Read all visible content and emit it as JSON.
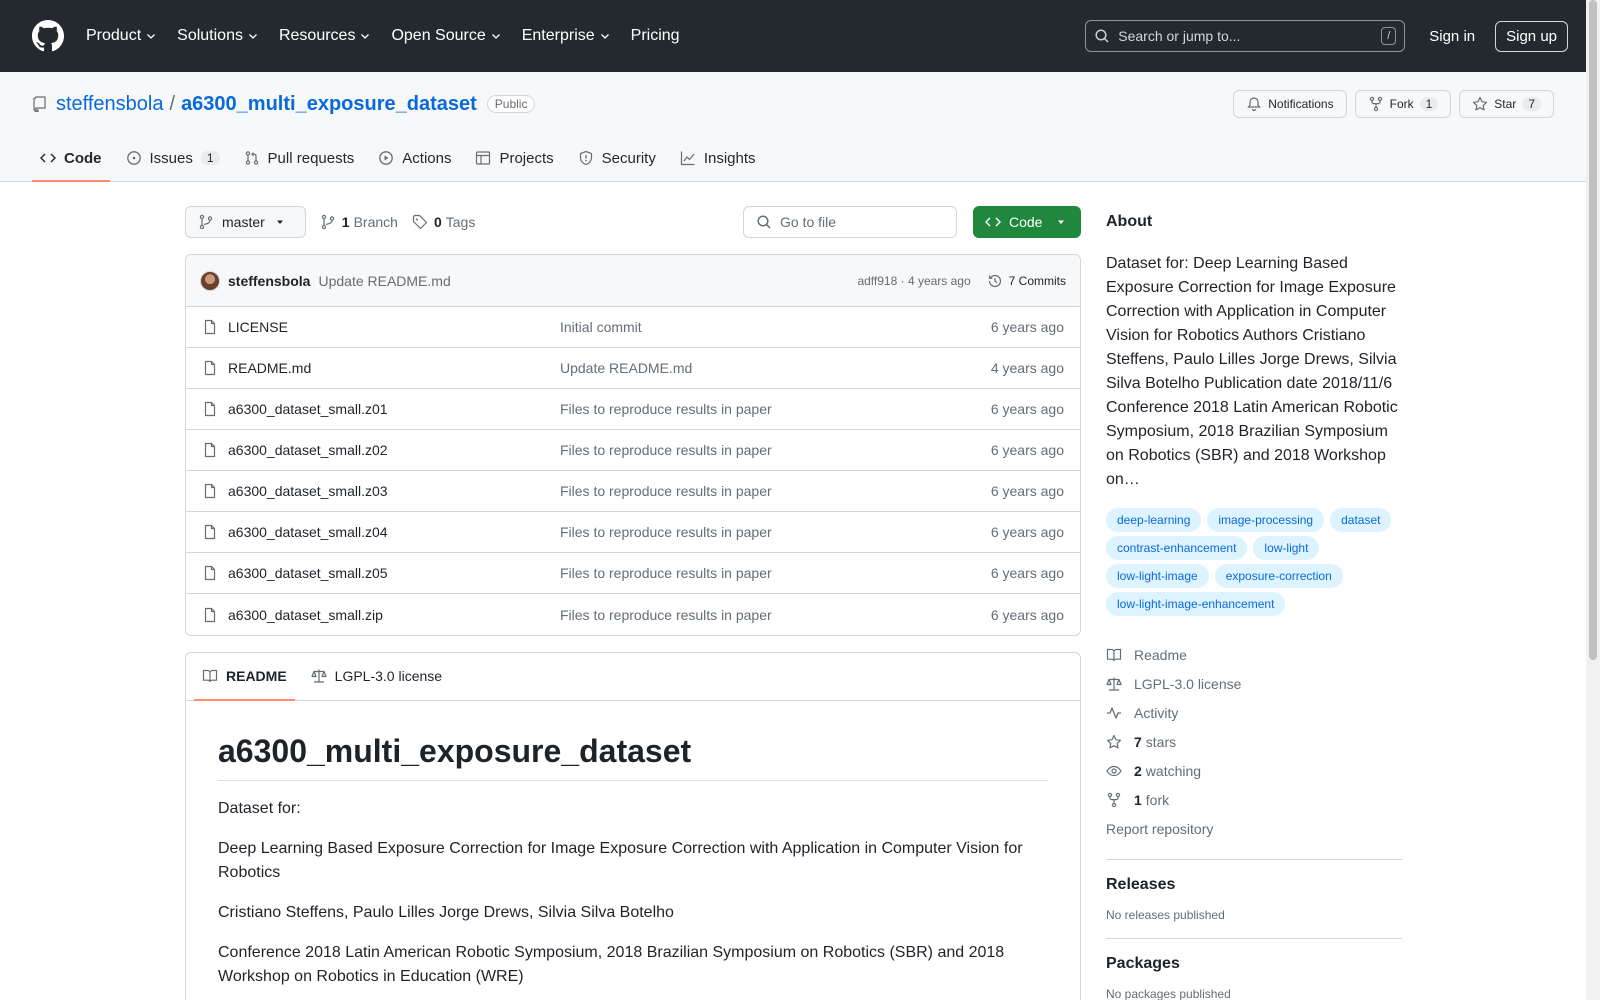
{
  "header": {
    "nav": [
      "Product",
      "Solutions",
      "Resources",
      "Open Source",
      "Enterprise",
      "Pricing"
    ],
    "search_placeholder": "Search or jump to...",
    "search_key": "/",
    "signin": "Sign in",
    "signup": "Sign up"
  },
  "repo": {
    "owner": "steffensbola",
    "separator": "/",
    "name": "a6300_multi_exposure_dataset",
    "visibility": "Public",
    "notifications": "Notifications",
    "fork_label": "Fork",
    "fork_count": "1",
    "star_label": "Star",
    "star_count": "7"
  },
  "tabs": [
    {
      "label": "Code",
      "icon": "code-icon"
    },
    {
      "label": "Issues",
      "icon": "issue-icon",
      "count": "1"
    },
    {
      "label": "Pull requests",
      "icon": "pull-request-icon"
    },
    {
      "label": "Actions",
      "icon": "play-icon"
    },
    {
      "label": "Projects",
      "icon": "table-icon"
    },
    {
      "label": "Security",
      "icon": "shield-icon"
    },
    {
      "label": "Insights",
      "icon": "graph-icon"
    }
  ],
  "toolbar": {
    "branch": "master",
    "branch_count": "1",
    "branch_label": "Branch",
    "tag_count": "0",
    "tag_label": "Tags",
    "goto_placeholder": "Go to file",
    "code_button": "Code"
  },
  "commit": {
    "author": "steffensbola",
    "message": "Update README.md",
    "meta": "adff918 · 4 years ago",
    "commits": "7 Commits"
  },
  "files": [
    {
      "name": "LICENSE",
      "commit": "Initial commit",
      "age": "6 years ago"
    },
    {
      "name": "README.md",
      "commit": "Update README.md",
      "age": "4 years ago"
    },
    {
      "name": "a6300_dataset_small.z01",
      "commit": "Files to reproduce results in paper",
      "age": "6 years ago"
    },
    {
      "name": "a6300_dataset_small.z02",
      "commit": "Files to reproduce results in paper",
      "age": "6 years ago"
    },
    {
      "name": "a6300_dataset_small.z03",
      "commit": "Files to reproduce results in paper",
      "age": "6 years ago"
    },
    {
      "name": "a6300_dataset_small.z04",
      "commit": "Files to reproduce results in paper",
      "age": "6 years ago"
    },
    {
      "name": "a6300_dataset_small.z05",
      "commit": "Files to reproduce results in paper",
      "age": "6 years ago"
    },
    {
      "name": "a6300_dataset_small.zip",
      "commit": "Files to reproduce results in paper",
      "age": "6 years ago"
    }
  ],
  "readme": {
    "tab_readme": "README",
    "tab_license": "LGPL-3.0 license",
    "title": "a6300_multi_exposure_dataset",
    "paragraphs": [
      "Dataset for:",
      "Deep Learning Based Exposure Correction for Image Exposure Correction with Application in Computer Vision for Robotics",
      "Cristiano Steffens, Paulo Lilles Jorge Drews, Silvia Silva Botelho",
      "Conference 2018 Latin American Robotic Symposium, 2018 Brazilian Symposium on Robotics (SBR) and 2018 Workshop on Robotics in Education (WRE)"
    ]
  },
  "about": {
    "title": "About",
    "description": "Dataset for: Deep Learning Based Exposure Correction for Image Exposure Correction with Application in Computer Vision for Robotics Authors Cristiano Steffens, Paulo Lilles Jorge Drews, Silvia Silva Botelho Publication date 2018/11/6 Conference 2018 Latin American Robotic Symposium, 2018 Brazilian Symposium on Robotics (SBR) and 2018 Workshop on…",
    "topics": [
      "deep-learning",
      "image-processing",
      "dataset",
      "contrast-enhancement",
      "low-light",
      "low-light-image",
      "exposure-correction",
      "low-light-image-enhancement"
    ],
    "readme": "Readme",
    "license": "LGPL-3.0 license",
    "activity": "Activity",
    "stars_count": "7",
    "stars_label": "stars",
    "watching_count": "2",
    "watching_label": "watching",
    "fork_count": "1",
    "fork_label": "fork",
    "report": "Report repository"
  },
  "releases": {
    "title": "Releases",
    "text": "No releases published"
  },
  "packages": {
    "title": "Packages",
    "text": "No packages published"
  },
  "colors": {
    "header_bg": "#24292f",
    "link": "#0969da",
    "primary_button": "#1f883d",
    "tab_underline": "#fd8c73",
    "topic_bg": "#ddf4ff"
  }
}
